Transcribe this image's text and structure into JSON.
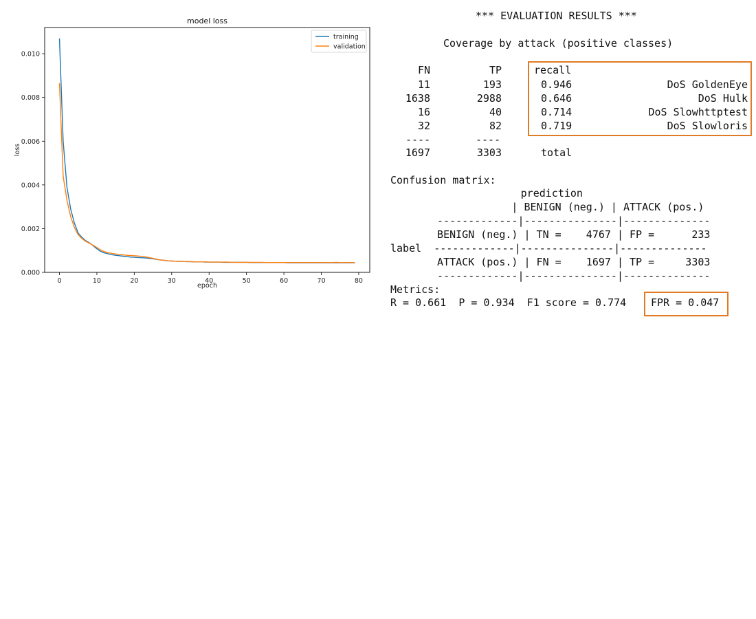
{
  "chart_data": {
    "type": "line",
    "title": "model loss",
    "xlabel": "epoch",
    "ylabel": "loss",
    "xlim": [
      -3.95,
      82.95
    ],
    "ylim": [
      0,
      0.0112
    ],
    "xticks": [
      0,
      10,
      20,
      30,
      40,
      50,
      60,
      70,
      80
    ],
    "yticks": [
      0.0,
      0.002,
      0.004,
      0.006,
      0.008,
      0.01
    ],
    "ytick_labels": [
      "0.000",
      "0.002",
      "0.004",
      "0.006",
      "0.008",
      "0.010"
    ],
    "legend_position": "top-right",
    "grid": false,
    "series": [
      {
        "name": "training",
        "color": "#1f77b4",
        "x": [
          0,
          1,
          2,
          3,
          4,
          5,
          6,
          7,
          8,
          9,
          10,
          11,
          12,
          13,
          14,
          15,
          16,
          17,
          18,
          19,
          20,
          21,
          22,
          23,
          24,
          25,
          26,
          27,
          28,
          29,
          30,
          31,
          32,
          33,
          34,
          35,
          36,
          37,
          38,
          39,
          40,
          41,
          42,
          43,
          44,
          45,
          46,
          47,
          48,
          49,
          50,
          51,
          52,
          53,
          54,
          55,
          56,
          57,
          58,
          59,
          60,
          61,
          62,
          63,
          64,
          65,
          66,
          67,
          68,
          69,
          70,
          71,
          72,
          73,
          74,
          75,
          76,
          77,
          78,
          79
        ],
        "y": [
          0.0107,
          0.006,
          0.0039,
          0.0029,
          0.00225,
          0.0018,
          0.0016,
          0.00145,
          0.00135,
          0.00122,
          0.00108,
          0.00096,
          0.00089,
          0.00085,
          0.00081,
          0.00078,
          0.00076,
          0.00074,
          0.00072,
          0.0007,
          0.00069,
          0.00068,
          0.00067,
          0.00066,
          0.00064,
          0.00062,
          0.00059,
          0.00057,
          0.00055,
          0.00053,
          0.00052,
          0.00051,
          0.0005,
          0.0005,
          0.00049,
          0.00049,
          0.00048,
          0.00048,
          0.00048,
          0.00047,
          0.00047,
          0.00047,
          0.00047,
          0.00047,
          0.00046,
          0.00046,
          0.00046,
          0.00046,
          0.00046,
          0.00046,
          0.00046,
          0.00045,
          0.00045,
          0.00045,
          0.00045,
          0.00045,
          0.00045,
          0.00045,
          0.00045,
          0.00045,
          0.00045,
          0.00044,
          0.00044,
          0.00044,
          0.00044,
          0.00044,
          0.00044,
          0.00044,
          0.00044,
          0.00044,
          0.00044,
          0.00044,
          0.00044,
          0.00044,
          0.00044,
          0.00044,
          0.00044,
          0.00044,
          0.00044,
          0.00044
        ]
      },
      {
        "name": "validation",
        "color": "#ff7f0e",
        "x": [
          0,
          1,
          2,
          3,
          4,
          5,
          6,
          7,
          8,
          9,
          10,
          11,
          12,
          13,
          14,
          15,
          16,
          17,
          18,
          19,
          20,
          21,
          22,
          23,
          24,
          25,
          26,
          27,
          28,
          29,
          30,
          31,
          32,
          33,
          34,
          35,
          36,
          37,
          38,
          39,
          40,
          41,
          42,
          43,
          44,
          45,
          46,
          47,
          48,
          49,
          50,
          51,
          52,
          53,
          54,
          55,
          56,
          57,
          58,
          59,
          60,
          61,
          62,
          63,
          64,
          65,
          66,
          67,
          68,
          69,
          70,
          71,
          72,
          73,
          74,
          75,
          76,
          77,
          78,
          79
        ],
        "y": [
          0.00865,
          0.0044,
          0.0033,
          0.00255,
          0.00205,
          0.00172,
          0.00155,
          0.00142,
          0.00133,
          0.00124,
          0.00114,
          0.00102,
          0.00095,
          0.0009,
          0.00087,
          0.00084,
          0.00082,
          0.0008,
          0.00078,
          0.00077,
          0.00076,
          0.00075,
          0.00073,
          0.00071,
          0.00068,
          0.00064,
          0.0006,
          0.00057,
          0.00055,
          0.00053,
          0.00052,
          0.00051,
          0.0005,
          0.0005,
          0.00049,
          0.00049,
          0.00048,
          0.00048,
          0.00048,
          0.00048,
          0.00047,
          0.00047,
          0.00047,
          0.00047,
          0.00047,
          0.00047,
          0.00046,
          0.00046,
          0.00046,
          0.00046,
          0.00046,
          0.00046,
          0.00046,
          0.00046,
          0.00046,
          0.00045,
          0.00045,
          0.00045,
          0.00045,
          0.00045,
          0.00045,
          0.00045,
          0.00045,
          0.00045,
          0.00045,
          0.00045,
          0.00045,
          0.00045,
          0.00045,
          0.00045,
          0.00045,
          0.00045,
          0.00045,
          0.00045,
          0.00046,
          0.00045,
          0.00045,
          0.00045,
          0.00045,
          0.00045
        ]
      }
    ]
  },
  "report": {
    "heading": "*** EVALUATION RESULTS ***",
    "coverage_title": "Coverage by attack (positive classes)",
    "headers": {
      "fn": "FN",
      "tp": "TP",
      "recall": "recall"
    },
    "rows": [
      {
        "fn": "11",
        "tp": "193",
        "recall": "0.946",
        "name": "DoS GoldenEye"
      },
      {
        "fn": "1638",
        "tp": "2988",
        "recall": "0.646",
        "name": "DoS Hulk"
      },
      {
        "fn": "16",
        "tp": "40",
        "recall": "0.714",
        "name": "DoS Slowhttptest"
      },
      {
        "fn": "32",
        "tp": "82",
        "recall": "0.719",
        "name": "DoS Slowloris"
      }
    ],
    "separator": "----",
    "total": {
      "fn": "1697",
      "tp": "3303",
      "label": "total"
    },
    "confusion_title": "Confusion matrix:",
    "cm_lines": [
      "                     prediction",
      "              | BENIGN (neg.) | ATTACK (pos.)",
      "  -------------|---------------|--------------",
      "  BENIGN (neg.) | TN =    4767 | FP =      233",
      "label  -------------|---------------|--------------",
      "  ATTACK (pos.) | FN =    1697 | TP =     3303",
      "  -------------|---------------|--------------"
    ],
    "metrics_label": "Metrics:",
    "metrics_line": "R = 0.661  P = 0.934  F1 score = 0.774",
    "fpr": "FPR = 0.047",
    "highlight_color": "#e07b24"
  }
}
